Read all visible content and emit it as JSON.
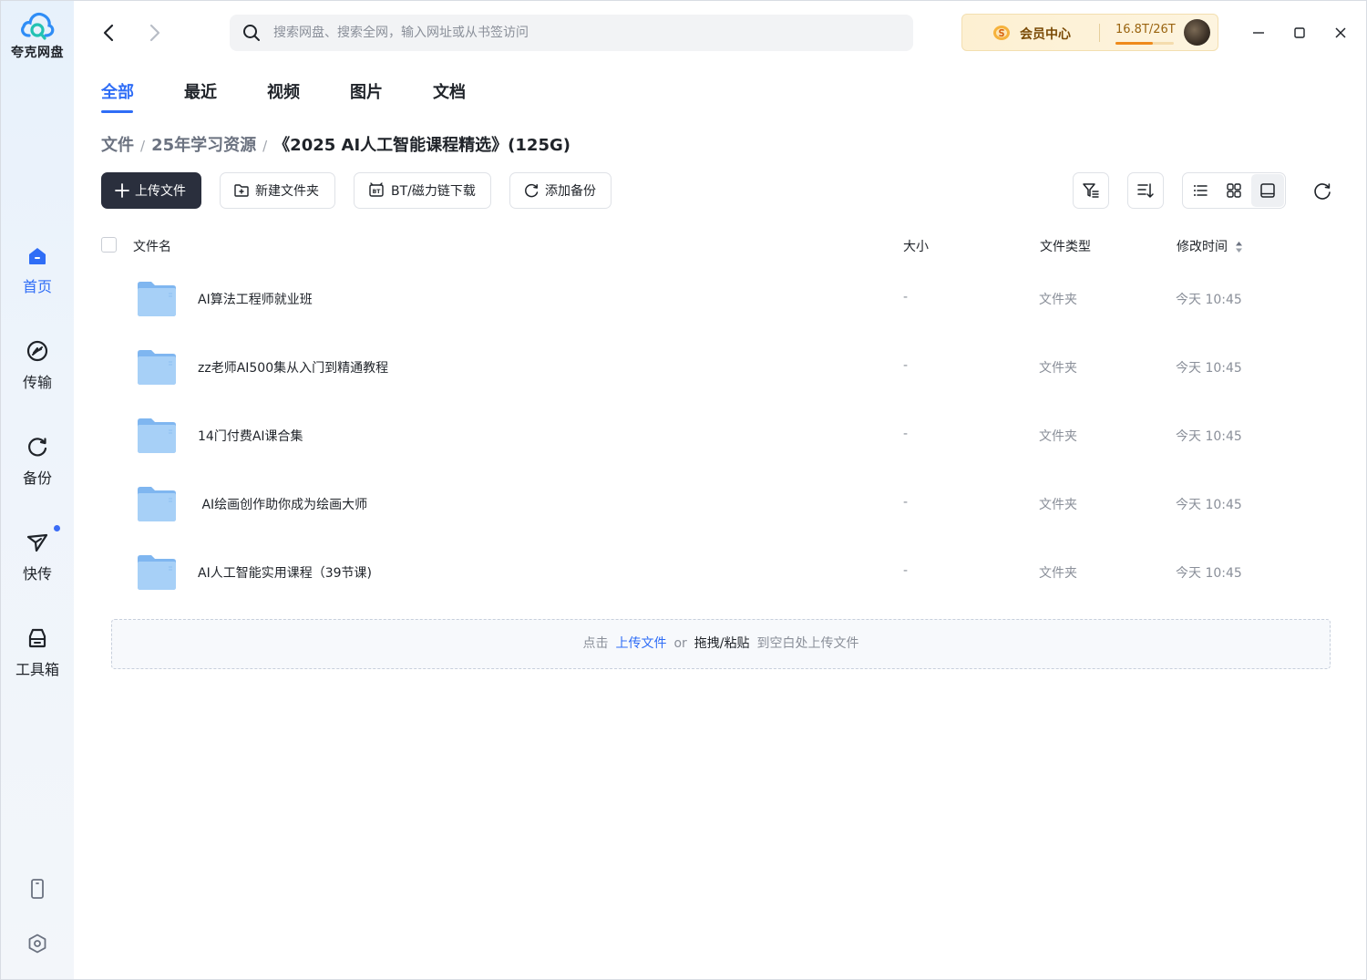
{
  "app": {
    "name": "夸克网盘"
  },
  "sidebar": {
    "items": [
      {
        "label": "首页",
        "icon": "home-icon",
        "active": true
      },
      {
        "label": "传输",
        "icon": "transfer-icon",
        "active": false
      },
      {
        "label": "备份",
        "icon": "backup-icon",
        "active": false
      },
      {
        "label": "快传",
        "icon": "send-icon",
        "active": false,
        "badge": true
      },
      {
        "label": "工具箱",
        "icon": "toolbox-icon",
        "active": false
      }
    ],
    "bottom_icons": [
      "phone-icon",
      "settings-icon"
    ]
  },
  "header": {
    "search_placeholder": "搜索网盘、搜索全网，输入网址或从书签访问",
    "vip": {
      "label": "会员中心",
      "storage": "16.8T/26T",
      "used_fraction": 0.646
    }
  },
  "tabs": [
    {
      "label": "全部",
      "active": true
    },
    {
      "label": "最近",
      "active": false
    },
    {
      "label": "视频",
      "active": false
    },
    {
      "label": "图片",
      "active": false
    },
    {
      "label": "文档",
      "active": false
    }
  ],
  "breadcrumb": [
    "文件",
    "25年学习资源",
    "《2025 AI人工智能课程精选》(125G)"
  ],
  "toolbar": {
    "upload": "上传文件",
    "new_folder": "新建文件夹",
    "bt_download": "BT/磁力链下载",
    "add_backup": "添加备份"
  },
  "table": {
    "columns": {
      "name": "文件名",
      "size": "大小",
      "type": "文件类型",
      "modified": "修改时间"
    },
    "rows": [
      {
        "name": "AI算法工程师就业班",
        "size": "-",
        "type": "文件夹",
        "modified": "今天 10:45"
      },
      {
        "name": "zz老师AI500集从入门到精通教程",
        "size": "-",
        "type": "文件夹",
        "modified": "今天 10:45"
      },
      {
        "name": "14门付费AI课合集",
        "size": "-",
        "type": "文件夹",
        "modified": "今天 10:45"
      },
      {
        "name": " AI绘画创作助你成为绘画大师",
        "size": "-",
        "type": "文件夹",
        "modified": "今天 10:45"
      },
      {
        "name": "AI人工智能实用课程（39节课)",
        "size": "-",
        "type": "文件夹",
        "modified": "今天 10:45"
      }
    ]
  },
  "dropzone": {
    "prefix": "点击",
    "upload_link": "上传文件",
    "or": "or",
    "drag": "拖拽/粘贴",
    "suffix": "到空白处上传文件"
  },
  "colors": {
    "accent": "#2f6df6",
    "primary_button": "#2a2f3d",
    "vip_bg": "#fdf0d2"
  }
}
